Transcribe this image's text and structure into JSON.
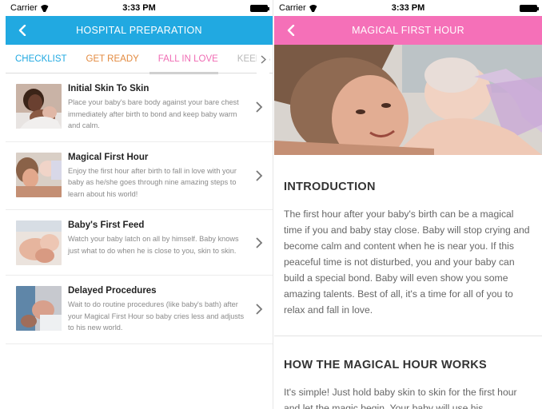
{
  "left_screen": {
    "status_bar": {
      "carrier": "Carrier",
      "time": "3:33 PM"
    },
    "nav": {
      "title": "HOSPITAL PREPARATION",
      "back_icon": "chevron-left-icon"
    },
    "tabs": [
      {
        "label": "CHECKLIST",
        "color": "#21a9e1"
      },
      {
        "label": "GET READY",
        "color": "#e38a3f"
      },
      {
        "label": "FALL IN LOVE",
        "color": "#f06cb4",
        "selected": true
      },
      {
        "label": "KEEP B",
        "color": "#b8b8b8"
      }
    ],
    "items": [
      {
        "title": "Initial Skin To Skin",
        "desc": "Place your baby's bare body against your bare chest immediately after birth to bond and keep baby warm and calm."
      },
      {
        "title": "Magical First Hour",
        "desc": "Enjoy the first hour after birth to fall in love with your baby as he/she goes through nine amazing steps to learn about his world!"
      },
      {
        "title": "Baby's First Feed",
        "desc": "Watch your baby latch on all by himself. Baby knows just what to do when he is close to you, skin to skin."
      },
      {
        "title": "Delayed Procedures",
        "desc": "Wait to do routine procedures (like baby's bath) after your Magical First Hour so baby cries less and adjusts to his new world."
      }
    ]
  },
  "right_screen": {
    "status_bar": {
      "carrier": "Carrier",
      "time": "3:33 PM"
    },
    "nav": {
      "title": "MAGICAL FIRST HOUR",
      "back_icon": "chevron-left-icon"
    },
    "sections": [
      {
        "heading": "INTRODUCTION",
        "body": "The first hour after your baby's birth can be a magical time if you and baby stay close. Baby will stop crying and become calm and content when he is near you. If this peaceful time is not disturbed, you and your baby can build a special bond. Baby will even show you some amazing talents. Best of all, it's a time for all of you to relax and fall in love."
      },
      {
        "heading": "HOW THE MAGICAL HOUR WORKS",
        "body": "It's simple! Just hold baby skin to skin for the first hour and let the magic begin. Your baby will use his"
      }
    ]
  },
  "colors": {
    "blue": "#21a9e1",
    "pink": "#f570b8",
    "orange": "#e38a3f"
  }
}
